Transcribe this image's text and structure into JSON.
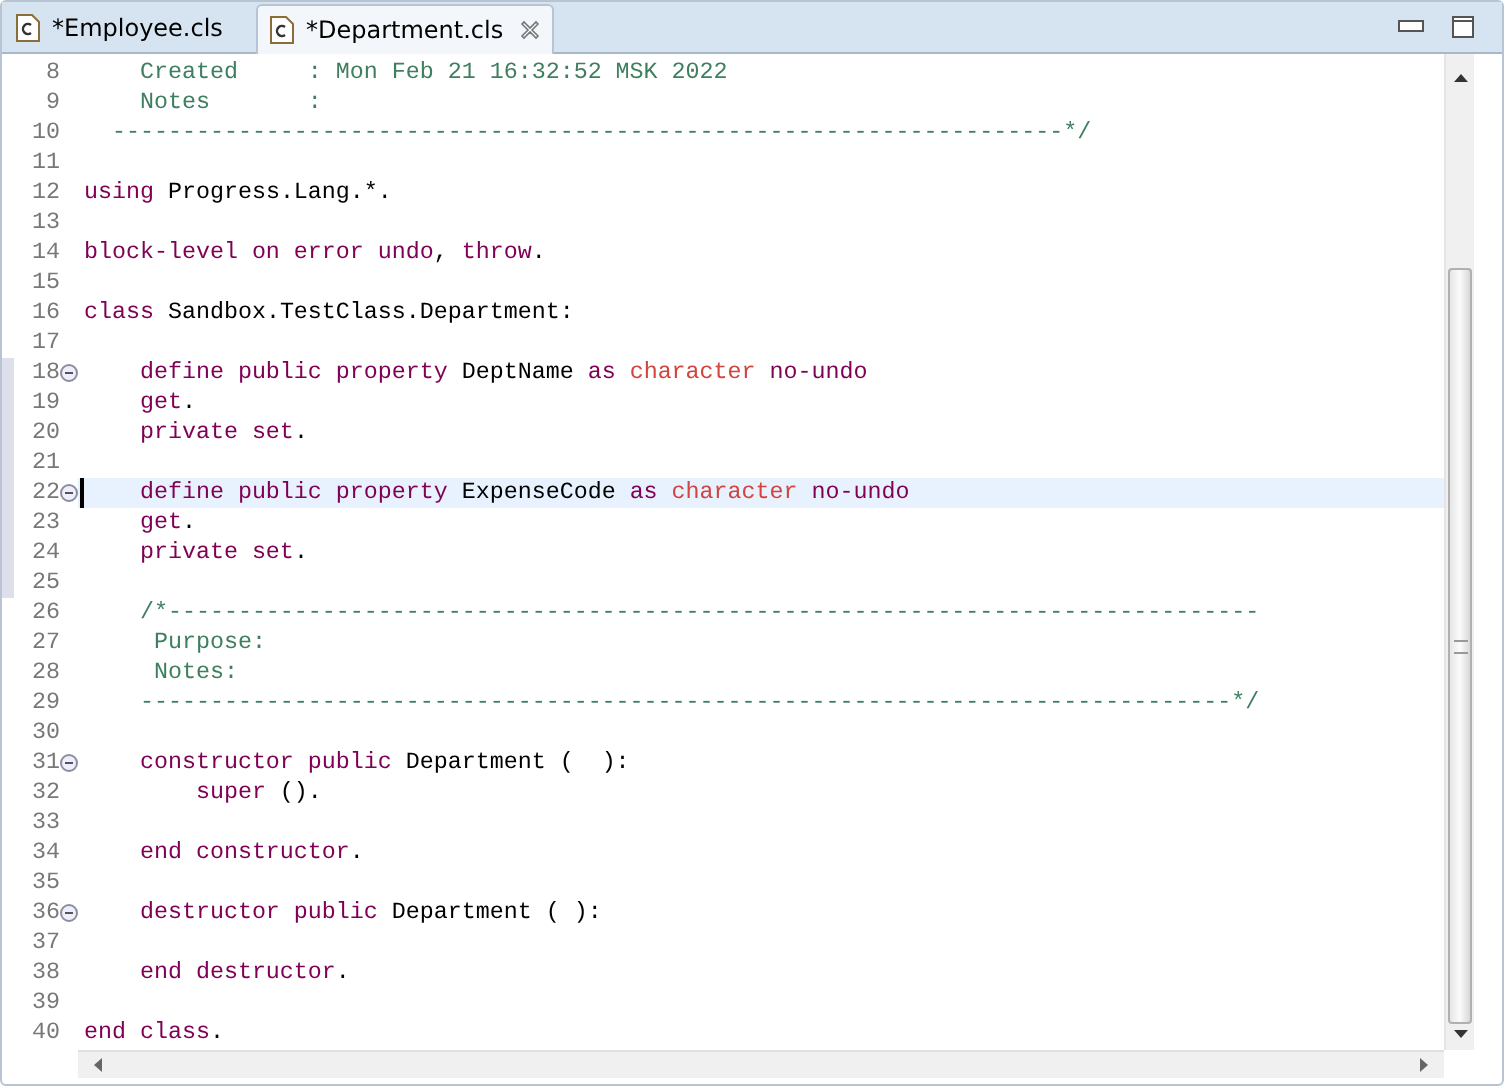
{
  "tabs": [
    {
      "label": "*Employee.cls",
      "selected": false,
      "closable": false
    },
    {
      "label": "*Department.cls",
      "selected": true,
      "closable": true
    }
  ],
  "editor": {
    "lines": [
      {
        "number": "8",
        "tokens": [
          {
            "kind": "comment",
            "text": "    Created     : Mon Feb 21 16:32:52 MSK 2022"
          }
        ]
      },
      {
        "number": "9",
        "tokens": [
          {
            "kind": "comment",
            "text": "    Notes       :"
          }
        ]
      },
      {
        "number": "10",
        "tokens": [
          {
            "kind": "comment",
            "text": "  --------------------------------------------------------------------*/"
          }
        ]
      },
      {
        "number": "11"
      },
      {
        "number": "12",
        "tokens": [
          {
            "kind": "keyword",
            "text": "using"
          },
          {
            "kind": "plain",
            "text": " Progress.Lang.*."
          }
        ]
      },
      {
        "number": "13"
      },
      {
        "number": "14",
        "tokens": [
          {
            "kind": "keyword",
            "text": "block-level on error undo"
          },
          {
            "kind": "plain",
            "text": ", "
          },
          {
            "kind": "keyword",
            "text": "throw"
          },
          {
            "kind": "plain",
            "text": "."
          }
        ]
      },
      {
        "number": "15"
      },
      {
        "number": "16",
        "tokens": [
          {
            "kind": "keyword",
            "text": "class"
          },
          {
            "kind": "plain",
            "text": " Sandbox.TestClass.Department:"
          }
        ]
      },
      {
        "number": "17"
      },
      {
        "number": "18",
        "foldable": true,
        "marked": true,
        "tokens": [
          {
            "kind": "keyword",
            "text": "    define public property"
          },
          {
            "kind": "plain",
            "text": " DeptName "
          },
          {
            "kind": "keyword",
            "text": "as"
          },
          {
            "kind": "type",
            "text": " character"
          },
          {
            "kind": "keyword",
            "text": " no-undo"
          }
        ]
      },
      {
        "number": "19",
        "marked": true,
        "tokens": [
          {
            "kind": "keyword",
            "text": "    get"
          },
          {
            "kind": "plain",
            "text": "."
          }
        ]
      },
      {
        "number": "20",
        "marked": true,
        "tokens": [
          {
            "kind": "keyword",
            "text": "    private set"
          },
          {
            "kind": "plain",
            "text": "."
          }
        ]
      },
      {
        "number": "21",
        "marked": true
      },
      {
        "number": "22",
        "foldable": true,
        "marked": true,
        "current": true,
        "tokens": [
          {
            "kind": "keyword",
            "text": "    define public property"
          },
          {
            "kind": "plain",
            "text": " ExpenseCode "
          },
          {
            "kind": "keyword",
            "text": "as"
          },
          {
            "kind": "type",
            "text": " character"
          },
          {
            "kind": "keyword",
            "text": " no-undo"
          }
        ]
      },
      {
        "number": "23",
        "marked": true,
        "tokens": [
          {
            "kind": "keyword",
            "text": "    get"
          },
          {
            "kind": "plain",
            "text": "."
          }
        ]
      },
      {
        "number": "24",
        "marked": true,
        "tokens": [
          {
            "kind": "keyword",
            "text": "    private set"
          },
          {
            "kind": "plain",
            "text": "."
          }
        ]
      },
      {
        "number": "25",
        "marked": true
      },
      {
        "number": "26",
        "tokens": [
          {
            "kind": "comment",
            "text": "    /*------------------------------------------------------------------------------"
          }
        ]
      },
      {
        "number": "27",
        "tokens": [
          {
            "kind": "comment",
            "text": "     Purpose:"
          }
        ]
      },
      {
        "number": "28",
        "tokens": [
          {
            "kind": "comment",
            "text": "     Notes:"
          }
        ]
      },
      {
        "number": "29",
        "tokens": [
          {
            "kind": "comment",
            "text": "    ------------------------------------------------------------------------------*/"
          }
        ]
      },
      {
        "number": "30"
      },
      {
        "number": "31",
        "foldable": true,
        "tokens": [
          {
            "kind": "keyword",
            "text": "    constructor public"
          },
          {
            "kind": "plain",
            "text": " Department (  ):"
          }
        ]
      },
      {
        "number": "32",
        "tokens": [
          {
            "kind": "keyword",
            "text": "        super"
          },
          {
            "kind": "plain",
            "text": " ()."
          }
        ]
      },
      {
        "number": "33"
      },
      {
        "number": "34",
        "tokens": [
          {
            "kind": "keyword",
            "text": "    end constructor"
          },
          {
            "kind": "plain",
            "text": "."
          }
        ]
      },
      {
        "number": "35"
      },
      {
        "number": "36",
        "foldable": true,
        "tokens": [
          {
            "kind": "keyword",
            "text": "    destructor public"
          },
          {
            "kind": "plain",
            "text": " Department ( ):"
          }
        ]
      },
      {
        "number": "37"
      },
      {
        "number": "38",
        "tokens": [
          {
            "kind": "keyword",
            "text": "    end destructor"
          },
          {
            "kind": "plain",
            "text": "."
          }
        ]
      },
      {
        "number": "39"
      },
      {
        "number": "40",
        "tokens": [
          {
            "kind": "keyword",
            "text": "end class"
          },
          {
            "kind": "plain",
            "text": "."
          }
        ]
      }
    ]
  }
}
